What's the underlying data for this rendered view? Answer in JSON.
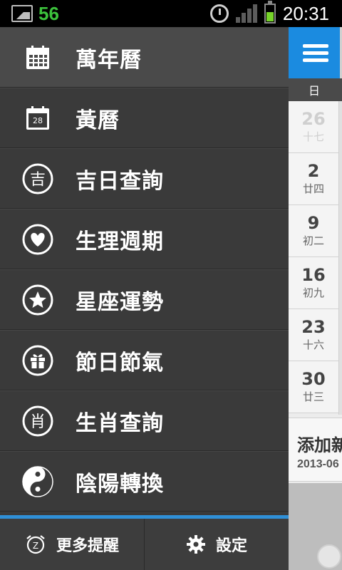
{
  "status_bar": {
    "notification_count": "56",
    "time": "20:31",
    "icons": [
      "image-icon",
      "alarm-icon",
      "signal-icon",
      "battery-icon"
    ]
  },
  "drawer": {
    "items": [
      {
        "label": "萬年曆",
        "icon": "calendar-grid-icon"
      },
      {
        "label": "黃曆",
        "icon": "calendar-day-icon",
        "icon_text": "28"
      },
      {
        "label": "吉日查詢",
        "icon": "auspicious-icon",
        "icon_text": "吉"
      },
      {
        "label": "生理週期",
        "icon": "heart-icon"
      },
      {
        "label": "星座運勢",
        "icon": "star-icon"
      },
      {
        "label": "節日節氣",
        "icon": "gift-icon"
      },
      {
        "label": "生肖查詢",
        "icon": "zodiac-icon",
        "icon_text": "肖"
      },
      {
        "label": "陰陽轉換",
        "icon": "yin-yang-icon"
      }
    ],
    "bottom": {
      "reminder_label": "更多提醒",
      "settings_label": "設定"
    }
  },
  "calendar": {
    "weekday_header": "日",
    "dates": [
      {
        "day": "26",
        "lunar": "十七",
        "dim": true
      },
      {
        "day": "2",
        "lunar": "廿四"
      },
      {
        "day": "9",
        "lunar": "初二"
      },
      {
        "day": "16",
        "lunar": "初九"
      },
      {
        "day": "23",
        "lunar": "十六"
      },
      {
        "day": "30",
        "lunar": "廿三"
      }
    ],
    "add_card": {
      "title": "添加新",
      "date": "2013-06"
    }
  },
  "colors": {
    "accent": "#1b8be0",
    "drawer_bg": "#3a3a3a",
    "status_green": "#3cc23c"
  }
}
